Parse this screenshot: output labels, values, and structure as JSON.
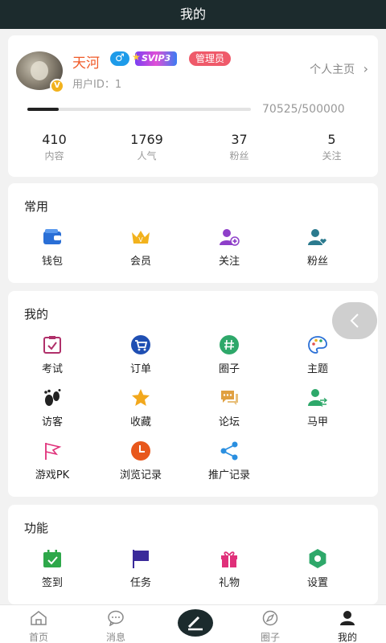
{
  "header": {
    "title": "我的"
  },
  "profile": {
    "name": "天河",
    "gender_symbol": "♂",
    "vip_badge": "SVIP3",
    "role_badge": "管理员",
    "verified_mark": "V",
    "user_id": "用户ID：1",
    "home_link": "个人主页",
    "home_chevron": "›",
    "progress_text": "70525/500000",
    "progress_fraction": 0.141,
    "stats": [
      {
        "value": "410",
        "label": "内容"
      },
      {
        "value": "1769",
        "label": "人气"
      },
      {
        "value": "37",
        "label": "粉丝"
      },
      {
        "value": "5",
        "label": "关注"
      }
    ]
  },
  "common": {
    "title": "常用",
    "items": [
      {
        "label": "钱包",
        "icon": "wallet-icon",
        "color": "#2a6fd6"
      },
      {
        "label": "会员",
        "icon": "crown-icon",
        "color": "#f2b21d"
      },
      {
        "label": "关注",
        "icon": "add-user-icon",
        "color": "#8e3fc9"
      },
      {
        "label": "粉丝",
        "icon": "user-heart-icon",
        "color": "#2b7a8e"
      }
    ]
  },
  "mine": {
    "title": "我的",
    "items": [
      {
        "label": "考试",
        "icon": "exam-icon",
        "color": "#b0306a"
      },
      {
        "label": "订单",
        "icon": "cart-icon",
        "color": "#1f4fb3"
      },
      {
        "label": "圈子",
        "icon": "hashtag-icon",
        "color": "#2ea86a"
      },
      {
        "label": "主题",
        "icon": "palette-icon",
        "color": "#2a6fd6"
      },
      {
        "label": "访客",
        "icon": "footprint-icon",
        "color": "#222222"
      },
      {
        "label": "收藏",
        "icon": "star-icon",
        "color": "#f2a81d"
      },
      {
        "label": "论坛",
        "icon": "chat-icon",
        "color": "#e0a040"
      },
      {
        "label": "马甲",
        "icon": "user-switch-icon",
        "color": "#2ea86a"
      },
      {
        "label": "游戏PK",
        "icon": "flag-icon",
        "color": "#e0307a"
      },
      {
        "label": "浏览记录",
        "icon": "clock-icon",
        "color": "#e8581c"
      },
      {
        "label": "推广记录",
        "icon": "share-icon",
        "color": "#2a8fe0"
      }
    ]
  },
  "func": {
    "title": "功能",
    "items": [
      {
        "label": "签到",
        "icon": "calendar-check-icon",
        "color": "#2ea84a"
      },
      {
        "label": "任务",
        "icon": "task-flag-icon",
        "color": "#3a2a9a"
      },
      {
        "label": "礼物",
        "icon": "gift-icon",
        "color": "#e0307a"
      },
      {
        "label": "设置",
        "icon": "settings-icon",
        "color": "#2ea86a"
      }
    ]
  },
  "bottom_nav": {
    "items": [
      {
        "label": "首页",
        "icon": "home-icon"
      },
      {
        "label": "消息",
        "icon": "message-icon"
      },
      {
        "label": "",
        "icon": "compose-icon"
      },
      {
        "label": "圈子",
        "icon": "compass-icon"
      },
      {
        "label": "我的",
        "icon": "person-icon",
        "active": true
      }
    ]
  }
}
